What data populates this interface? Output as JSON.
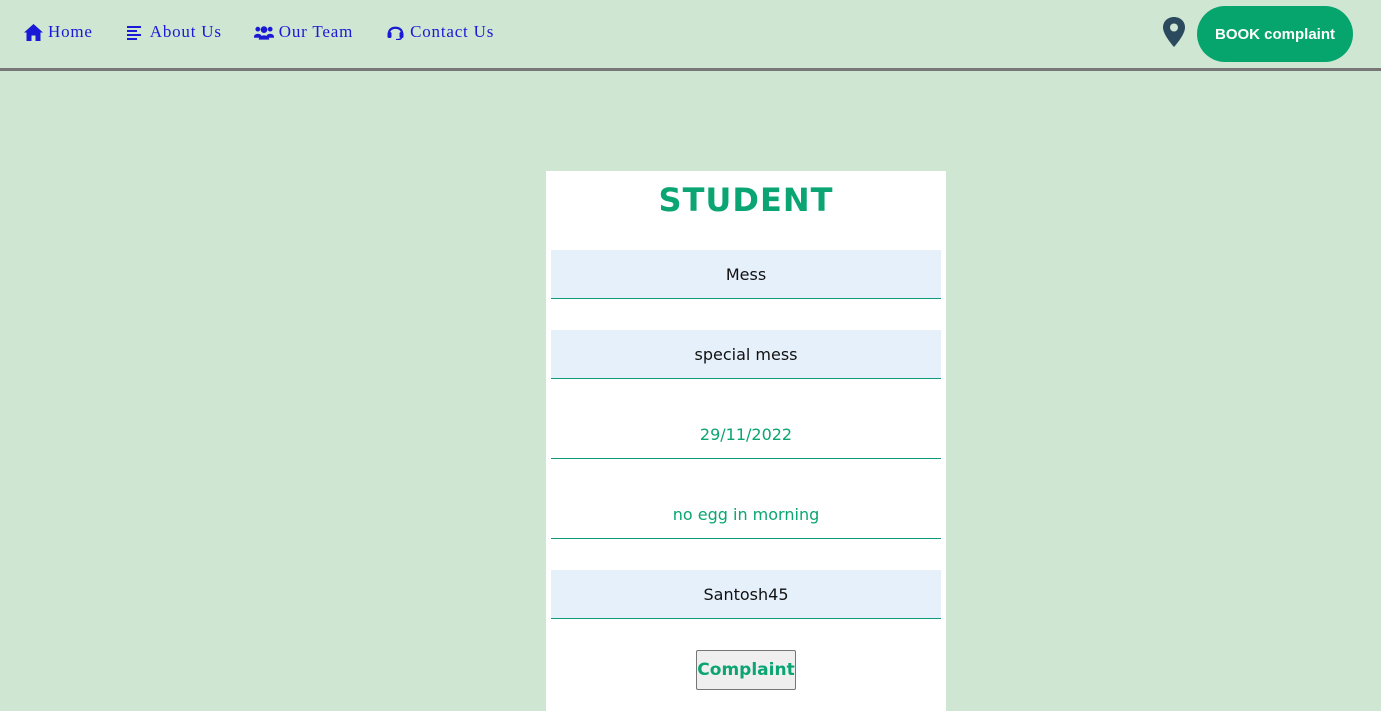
{
  "nav": {
    "items": [
      {
        "label": "Home",
        "icon": "home-icon"
      },
      {
        "label": "About Us",
        "icon": "align-left-icon"
      },
      {
        "label": "Our Team",
        "icon": "users-icon"
      },
      {
        "label": "Contact Us",
        "icon": "headset-icon"
      }
    ],
    "pin_icon": "map-pin-icon",
    "book_label": "BOOK complaint"
  },
  "form": {
    "title": "STUDENT",
    "fields": [
      {
        "name": "category",
        "value": "Mess"
      },
      {
        "name": "sub_category",
        "value": "special mess"
      },
      {
        "name": "date",
        "value": "29/11/2022"
      },
      {
        "name": "description",
        "value": "no egg in morning"
      },
      {
        "name": "username",
        "value": "Santosh45"
      }
    ],
    "submit_label": "Complaint"
  },
  "colors": {
    "background": "#cfe6d2",
    "accent": "#06a56d",
    "nav_link": "#1a1ad6",
    "field_fill": "#e6f0fb",
    "pin": "#2c4a5e"
  }
}
